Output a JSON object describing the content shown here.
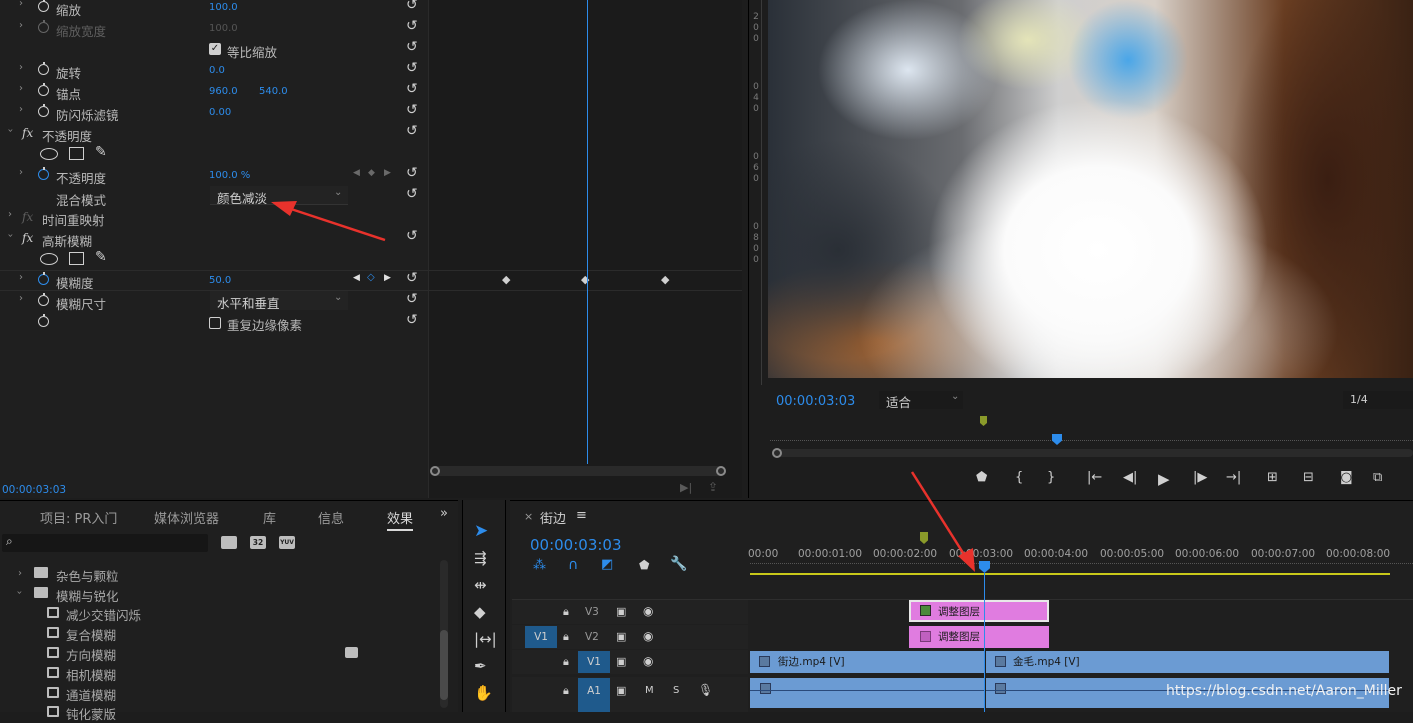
{
  "effect_controls": {
    "rows": [
      {
        "label": "缩放",
        "value": "100.0"
      },
      {
        "label": "缩放宽度",
        "value": "100.0"
      },
      {
        "label": "等比缩放"
      },
      {
        "label": "旋转",
        "value": "0.0"
      },
      {
        "label": "锚点",
        "value": "960.0",
        "value2": "540.0"
      },
      {
        "label": "防闪烁滤镜",
        "value": "0.00"
      },
      {
        "label": "不透明度"
      },
      {
        "label": "不透明度",
        "value": "100.0 %"
      },
      {
        "label": "混合模式",
        "value": "颜色减淡"
      },
      {
        "label": "时间重映射"
      },
      {
        "label": "高斯模糊"
      },
      {
        "label": "模糊度",
        "value": "50.0"
      },
      {
        "label": "模糊尺寸",
        "value": "水平和垂直"
      },
      {
        "label": "重复边缘像素"
      }
    ],
    "fx_symbol": "fx",
    "timecode": "00:00:03:03"
  },
  "program_monitor": {
    "timecode": "00:00:03:03",
    "fit_label": "适合",
    "resolution": "1/4",
    "ruler_digits": [
      "2",
      "0",
      "0",
      "0",
      "4",
      "0",
      "0",
      "6",
      "0",
      "0",
      "8",
      "0",
      "0"
    ]
  },
  "project_panel": {
    "tabs": [
      "项目: PR入门",
      "媒体浏览器",
      "库",
      "信息",
      "效果"
    ],
    "active_tab": "效果",
    "badges": [
      "32",
      "YUV"
    ],
    "tree": [
      {
        "label": "杂色与颗粒",
        "level": 0
      },
      {
        "label": "模糊与锐化",
        "level": 0
      },
      {
        "label": "减少交错闪烁",
        "level": 1
      },
      {
        "label": "复合模糊",
        "level": 1
      },
      {
        "label": "方向模糊",
        "level": 1
      },
      {
        "label": "相机模糊",
        "level": 1
      },
      {
        "label": "通道模糊",
        "level": 1
      },
      {
        "label": "钝化蒙版",
        "level": 1
      }
    ]
  },
  "timeline": {
    "sequence_name": "街边",
    "timecode": "00:00:03:03",
    "ruler": [
      "00:00",
      "00:00:01:00",
      "00:00:02:00",
      "00:00:03:00",
      "00:00:04:00",
      "00:00:05:00",
      "00:00:06:00",
      "00:00:07:00",
      "00:00:08:00"
    ],
    "tracks": [
      {
        "name": "V3"
      },
      {
        "name": "V2",
        "source": "V1"
      },
      {
        "name": "V1"
      },
      {
        "name": "A1"
      }
    ],
    "mute_label": "M",
    "solo_label": "S",
    "clips": {
      "v3": "调整图层",
      "v2": "调整图层",
      "v1_a": "街边.mp4 [V]",
      "v1_b": "金毛.mp4 [V]"
    }
  },
  "watermark": "https://blog.csdn.net/Aaron_Miller",
  "colors": {
    "accent": "#2d8ceb",
    "adjustment_clip": "#e07ce0",
    "video_clip": "#6b9bd3",
    "red_arrow": "#e8322c"
  }
}
